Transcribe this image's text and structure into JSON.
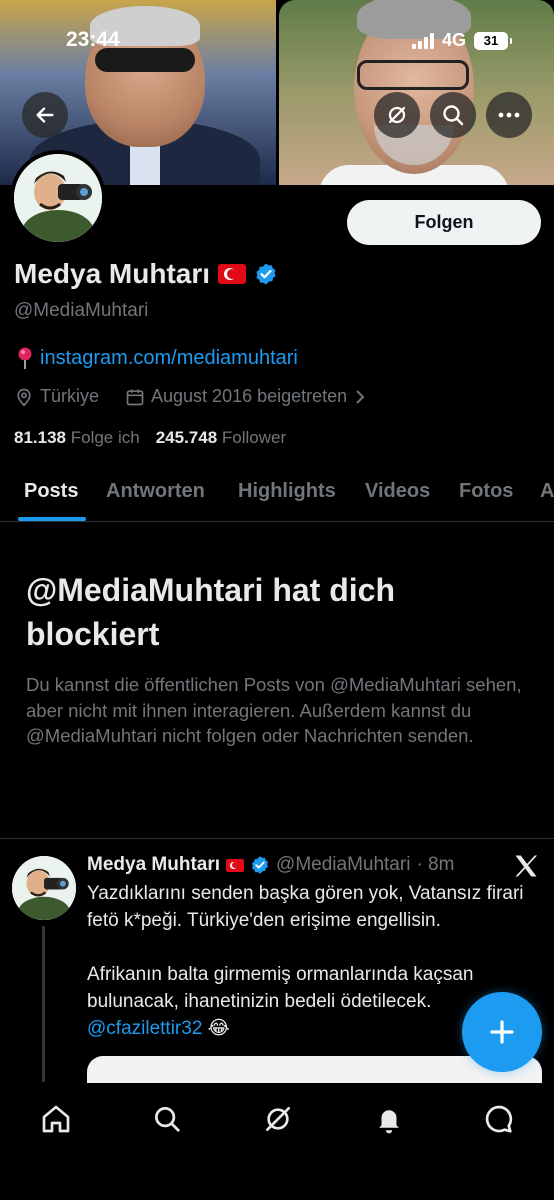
{
  "status_bar": {
    "time": "23:44",
    "network": "4G",
    "battery": "31"
  },
  "profile": {
    "follow_label": "Folgen",
    "name": "Medya Muhtarı",
    "handle": "@MediaMuhtari",
    "website": "instagram.com/mediamuhtari",
    "location": "Türkiye",
    "joined": "August 2016 beigetreten",
    "following_count": "81.138",
    "following_label": "Folge ich",
    "followers_count": "245.748",
    "followers_label": "Follower"
  },
  "tabs": [
    {
      "label": "Posts",
      "active": true
    },
    {
      "label": "Antworten"
    },
    {
      "label": "Highlights"
    },
    {
      "label": "Videos"
    },
    {
      "label": "Fotos"
    },
    {
      "label": "A"
    }
  ],
  "blocked": {
    "title": "@MediaMuhtari hat dich blockiert",
    "description": "Du kannst die öffentlichen Posts von @MediaMuhtari sehen, aber nicht mit ihnen interagieren. Außerdem kannst du @MediaMuhtari nicht folgen oder Nachrichten senden."
  },
  "post": {
    "author_name": "Medya Muhtarı",
    "author_handle": "@MediaMuhtari",
    "time": "· 8m",
    "text_1": "Yazdıklarını senden başka gören yok, Vatansız firari fetö k*peği. Türkiye'den erişime engellisin.",
    "text_2": "Afrikanın balta girmemiş ormanlarında kaçsan bulunacak, ihanetinizin bedeli ödetilecek.",
    "mention": "@cfazilettir32",
    "emoji": "😂"
  },
  "icons": {
    "back": "arrow-left-icon",
    "grok": "grok-icon",
    "search": "search-icon",
    "more": "more-icon",
    "location": "map-pin-icon",
    "calendar": "calendar-icon",
    "link": "pushpin-icon",
    "verified": "verified-badge-icon",
    "x": "x-logo-icon",
    "compose": "plus-icon",
    "nav": [
      "home-icon",
      "search-icon",
      "grok-icon",
      "bell-icon",
      "messages-icon"
    ]
  },
  "colors": {
    "accent": "#1d9bf0",
    "text": "#e7e9ea",
    "muted": "#71767b",
    "background": "#000000",
    "flag_red": "#e30a17"
  }
}
